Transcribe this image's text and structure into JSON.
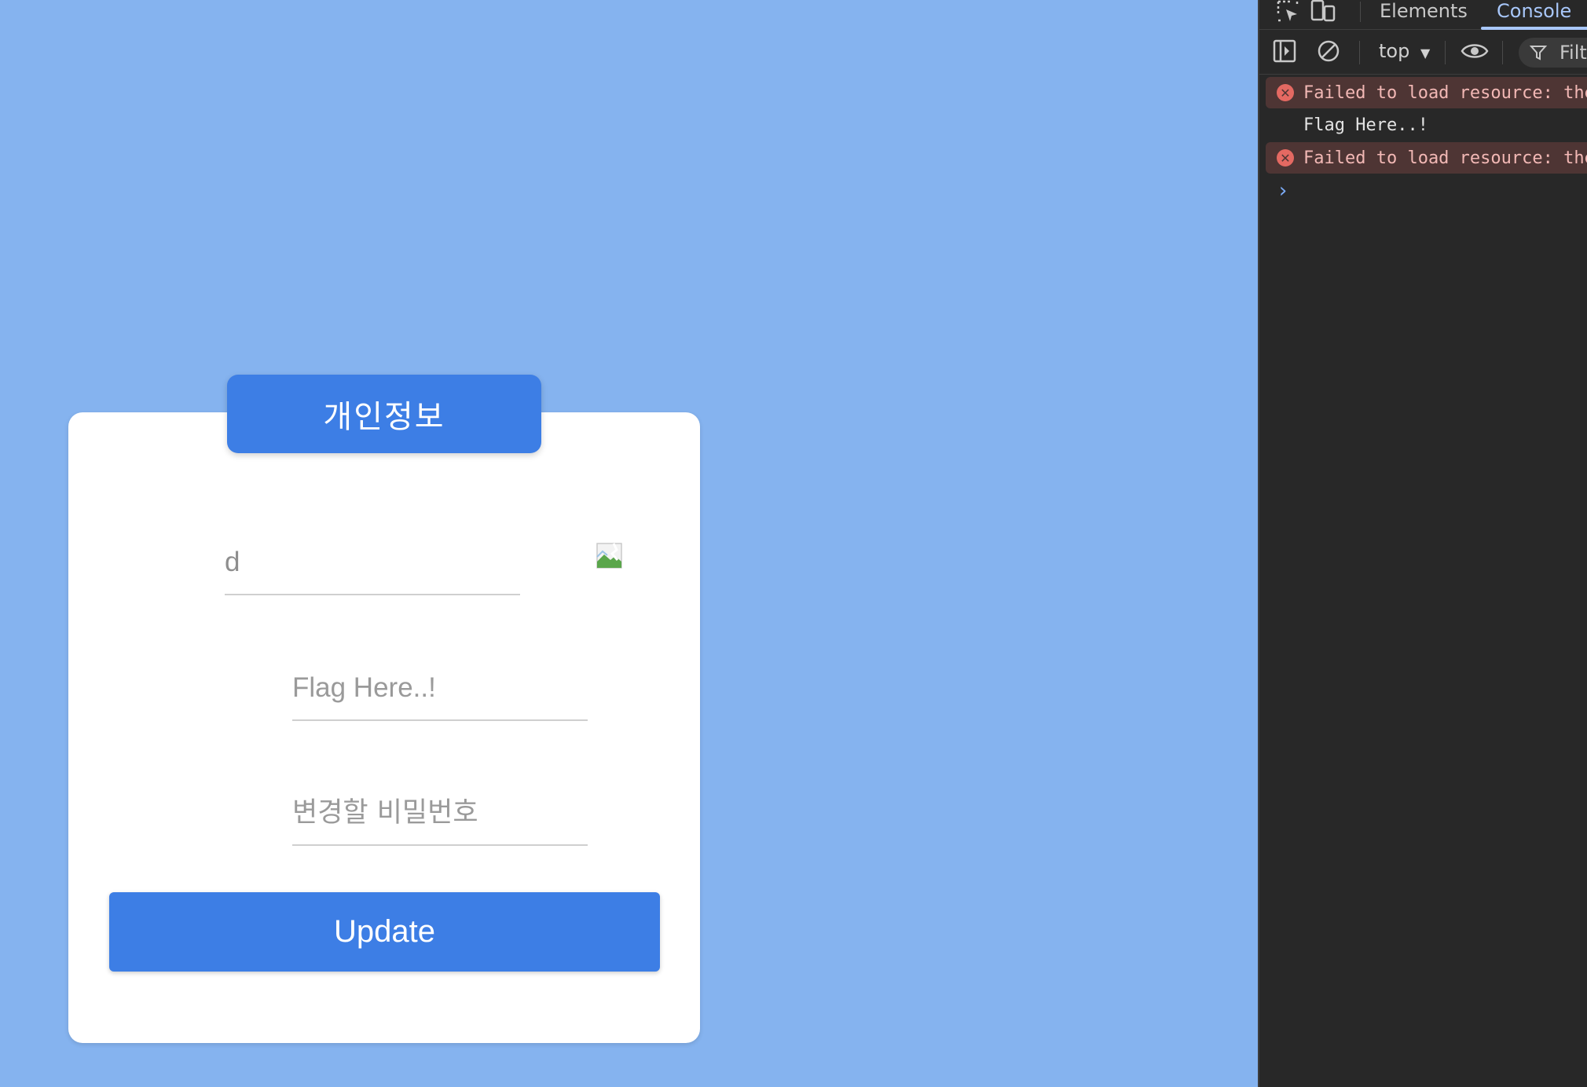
{
  "card": {
    "title": "개인정보",
    "id_value": "d",
    "flag_placeholder": "Flag Here..!",
    "password_placeholder": "변경할 비밀번호",
    "update_label": "Update"
  },
  "devtools": {
    "tabs": [
      "Elements",
      "Console"
    ],
    "active_tab": "Console",
    "context": "top",
    "filter_placeholder": "Filt",
    "messages": [
      {
        "level": "error",
        "text": "Failed to load resource: the"
      },
      {
        "level": "log",
        "text": "Flag Here..!"
      },
      {
        "level": "error",
        "text": "Failed to load resource: the"
      }
    ],
    "prompt": "›"
  },
  "colors": {
    "page_bg": "#85b3ef",
    "accent": "#3d7ee5",
    "devtools_bg": "#282828",
    "error_bg": "#4e3534",
    "error_text": "#f2b8b5",
    "active_tab": "#a8c7fa"
  }
}
